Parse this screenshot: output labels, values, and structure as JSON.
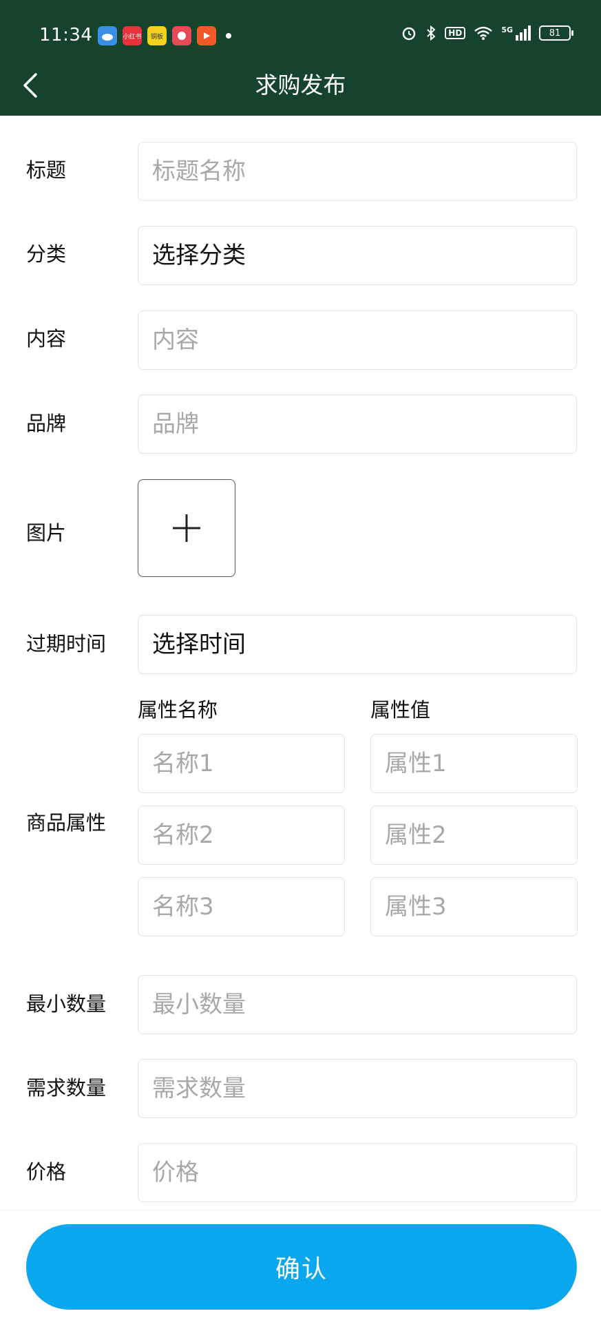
{
  "status_bar": {
    "time": "11:34",
    "app_icons": [
      {
        "name": "weather-app-icon",
        "color": "#3a8ee6",
        "label": ""
      },
      {
        "name": "xiaohongshu-app-icon",
        "color": "#e8323c",
        "label": "小红书"
      },
      {
        "name": "yellow-app-icon",
        "color": "#f4d21e",
        "label": "铜板"
      },
      {
        "name": "pinduoduo-app-icon",
        "color": "#e94a5a",
        "label": ""
      },
      {
        "name": "video-app-icon",
        "color": "#f05a28",
        "label": ""
      }
    ],
    "hd_label": "HD",
    "network_label": "5G",
    "battery_level": "81"
  },
  "nav": {
    "title": "求购发布",
    "back_icon": "chevron-left-icon"
  },
  "form": {
    "title": {
      "label": "标题",
      "placeholder": "标题名称"
    },
    "category": {
      "label": "分类",
      "value": "选择分类"
    },
    "content": {
      "label": "内容",
      "placeholder": "内容"
    },
    "brand": {
      "label": "品牌",
      "placeholder": "品牌"
    },
    "image": {
      "label": "图片",
      "add_icon": "plus-icon"
    },
    "expire": {
      "label": "过期时间",
      "value": "选择时间"
    },
    "attributes": {
      "label": "商品属性",
      "name_header": "属性名称",
      "value_header": "属性值",
      "names": [
        "名称1",
        "名称2",
        "名称3"
      ],
      "values": [
        "属性1",
        "属性2",
        "属性3"
      ]
    },
    "min_qty": {
      "label": "最小数量",
      "placeholder": "最小数量"
    },
    "demand_qty": {
      "label": "需求数量",
      "placeholder": "需求数量"
    },
    "price": {
      "label": "价格",
      "placeholder": "价格"
    }
  },
  "footer": {
    "confirm_label": "确认",
    "button_color": "#0aa7ef"
  },
  "colors": {
    "header_bg": "#16432c",
    "placeholder_text": "#a8a8a8",
    "border": "#e3e3e3"
  }
}
